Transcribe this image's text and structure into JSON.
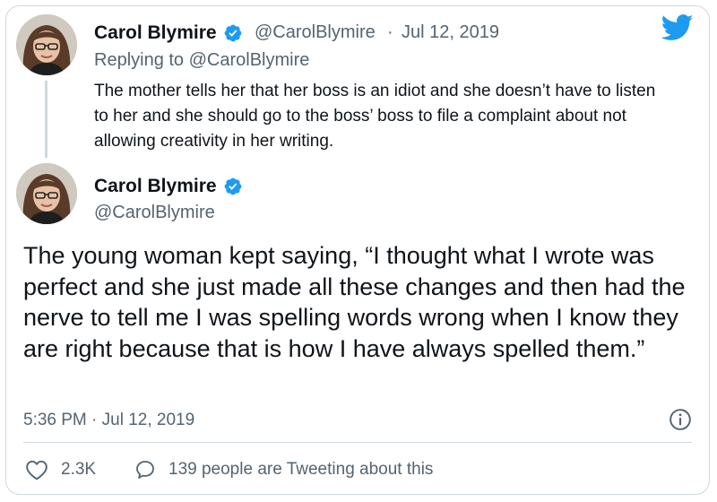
{
  "reply_tweet": {
    "author_name": "Carol Blymire",
    "author_handle": "@CarolBlymire",
    "date": "Jul 12, 2019",
    "replying_to": "Replying to @CarolBlymire",
    "text": "The mother tells her that her boss is an idiot and she doesn’t have to listen to her and she should go to the boss’ boss to file a complaint about not allowing creativity in her writing."
  },
  "main_tweet": {
    "author_name": "Carol Blymire",
    "author_handle": "@CarolBlymire",
    "text": "The young woman kept saying, “I thought what I wrote was perfect and she just made all these changes and then had the nerve to tell me I was spelling words wrong when I know they are right because that is how I have always spelled them.”",
    "timestamp": "5:36 PM · Jul 12, 2019"
  },
  "actions": {
    "likes": "2.3K",
    "tweeting": "139 people are Tweeting about this"
  },
  "colors": {
    "twitter_blue": "#1d9bf0",
    "secondary_text": "#536471",
    "border": "#cfd9de"
  }
}
